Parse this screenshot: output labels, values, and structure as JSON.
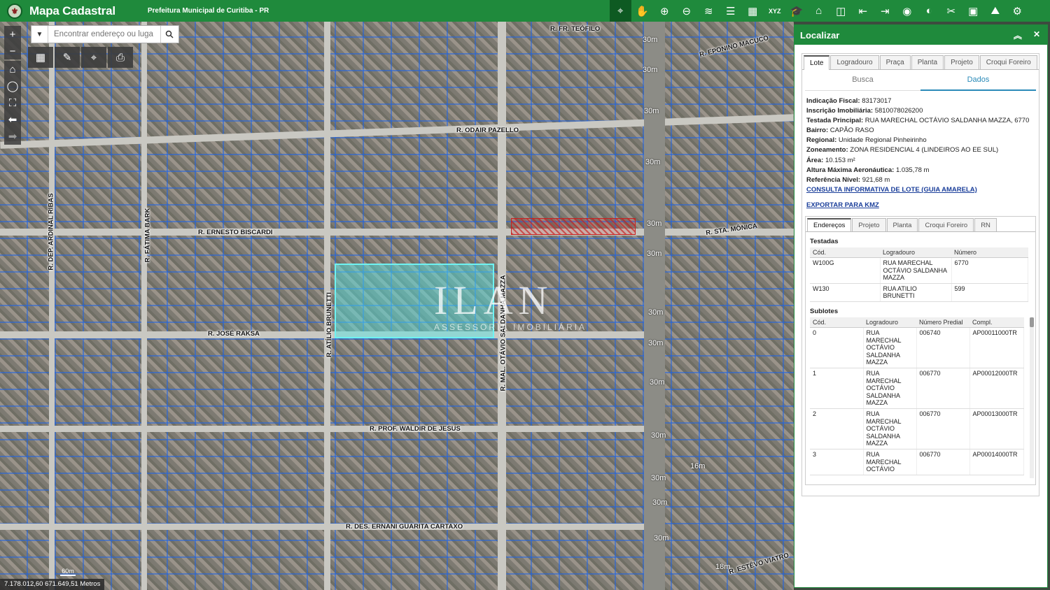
{
  "app": {
    "title": "Mapa Cadastral",
    "subtitle": "Prefeitura Municipal de Curitiba - PR",
    "brand_color": "#1f8a3c"
  },
  "toolbar": {
    "icons": [
      "identify-icon",
      "pan-icon",
      "zoom-in-icon",
      "zoom-out-icon",
      "layers-icon",
      "legend-icon",
      "basemap-icon",
      "coordinates-icon",
      "education-icon",
      "buildings-icon",
      "compare-icon",
      "import-icon",
      "export-icon",
      "target-icon",
      "globe-icon",
      "measure-tools-icon",
      "overlay-icon",
      "profile-icon",
      "settings-icon"
    ],
    "xyz_label": "XYZ"
  },
  "map": {
    "search_placeholder": "Encontrar endereço ou luga",
    "roads": [
      "R. FR. TEÓFILO",
      "R. EPONINO MACUCO",
      "R. ODAIR PAZELLO",
      "R. ERNESTO BISCARDI",
      "R. STA. MÔNICA",
      "R. JOSÉ RAKSA",
      "R. PROF. WALDIR DE JESUS",
      "R. DES. ERNANI GUARITA CARTAXO",
      "R. ESTÊVO VIATRO",
      "R. DEP. ARDINAL RIBAS",
      "R. FÁTIMA BARK",
      "R. ATÍLIO BRUNETTI",
      "R. MAL. OTÁVIO SALDANHA MAZZA"
    ],
    "distances": [
      "30m",
      "30m",
      "30m",
      "30m",
      "30m",
      "30m",
      "30m",
      "30m",
      "30m",
      "30m",
      "30m",
      "16m",
      "30m",
      "30m",
      "18m"
    ],
    "watermark": "ILAN",
    "watermark_sub": "ASSESSORIA IMOBILIÁRIA",
    "scale_label": "60m",
    "coordinates": "7.178.012,60 671.649,51 Metros"
  },
  "panel": {
    "title": "Localizar",
    "tabs": [
      "Lote",
      "Logradouro",
      "Praça",
      "Planta",
      "Projeto",
      "Croqui Foreiro"
    ],
    "subtabs": [
      "Busca",
      "Dados"
    ],
    "fields": [
      {
        "label": "Indicação Fiscal:",
        "value": "83173017"
      },
      {
        "label": "Inscrição Imobiliária:",
        "value": "5810078026200"
      },
      {
        "label": "Testada Principal:",
        "value": "RUA MARECHAL OCTÁVIO SALDANHA MAZZA, 6770"
      },
      {
        "label": "Bairro:",
        "value": "CAPÃO RASO"
      },
      {
        "label": "Regional:",
        "value": "Unidade Regional Pinheirinho"
      },
      {
        "label": "Zoneamento:",
        "value": "ZONA RESIDENCIAL 4 (LINDEIROS AO EE SUL)"
      },
      {
        "label": "Área:",
        "value": "10.153 m²"
      },
      {
        "label": "Altura Máxima Aeronáutica:",
        "value": "1.035,78 m"
      },
      {
        "label": "Referência Nível:",
        "value": "921,68 m"
      }
    ],
    "link_guia": "CONSULTA INFORMATIVA DE LOTE (GUIA AMARELA)",
    "link_kmz": "EXPORTAR PARA KMZ",
    "inner_tabs": [
      "Endereços",
      "Projeto",
      "Planta",
      "Croqui Foreiro",
      "RN"
    ],
    "testadas_title": "Testadas",
    "testadas_headers": [
      "Cód.",
      "Logradouro",
      "Número"
    ],
    "testadas_rows": [
      [
        "W100G",
        "RUA MARECHAL OCTÁVIO SALDANHA MAZZA",
        "6770"
      ],
      [
        "W130",
        "RUA ATILIO BRUNETTI",
        "599"
      ]
    ],
    "sublotes_title": "Sublotes",
    "sublotes_headers": [
      "Cód.",
      "Logradouro",
      "Número Predial",
      "Compl."
    ],
    "sublotes_rows": [
      [
        "0",
        "RUA MARECHAL OCTÁVIO SALDANHA MAZZA",
        "006740",
        "AP00011000TR"
      ],
      [
        "1",
        "RUA MARECHAL OCTÁVIO SALDANHA MAZZA",
        "006770",
        "AP00012000TR"
      ],
      [
        "2",
        "RUA MARECHAL OCTÁVIO SALDANHA MAZZA",
        "006770",
        "AP00013000TR"
      ],
      [
        "3",
        "RUA MARECHAL OCTÁVIO",
        "006770",
        "AP00014000TR"
      ]
    ]
  }
}
